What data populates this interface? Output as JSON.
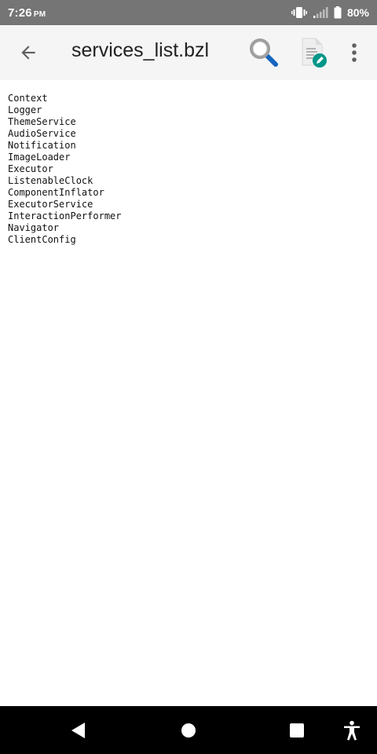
{
  "status_bar": {
    "time": "7:26",
    "ampm": "PM",
    "battery_percent": "80%",
    "icons": [
      "vibrate-icon",
      "signal-icon",
      "battery-icon"
    ]
  },
  "app_bar": {
    "title": "services_list.bzl",
    "icons": [
      "back-arrow-icon",
      "search-icon",
      "edit-file-icon",
      "more-vert-icon"
    ]
  },
  "file_content": {
    "lines": [
      "Context",
      "Logger",
      "ThemeService",
      "AudioService",
      "Notification",
      "ImageLoader",
      "Executor",
      "ListenableClock",
      "ComponentInflator",
      "ExecutorService",
      "InteractionPerformer",
      "Navigator",
      "ClientConfig"
    ]
  },
  "nav_bar": {
    "icons": [
      "nav-back-icon",
      "nav-home-icon",
      "nav-recents-icon",
      "accessibility-icon"
    ]
  },
  "colors": {
    "status_bar_bg": "#757575",
    "app_bar_bg": "#f5f5f5",
    "search_accent": "#1565c0",
    "edit_badge": "#009688",
    "nav_bar_bg": "#000000"
  }
}
